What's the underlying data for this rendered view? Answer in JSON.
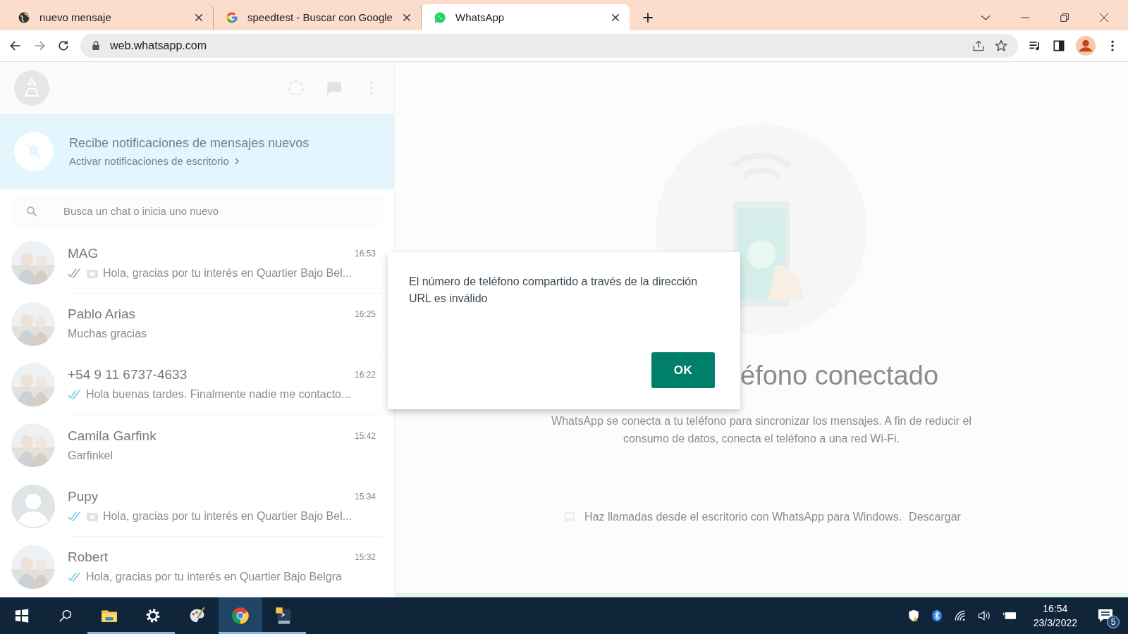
{
  "browser": {
    "tabs": [
      {
        "title": "nuevo mensaje",
        "kind": "globe",
        "selected": false
      },
      {
        "title": "speedtest - Buscar con Google",
        "kind": "google",
        "selected": false
      },
      {
        "title": "WhatsApp",
        "kind": "whatsapp",
        "selected": true
      }
    ],
    "address": "web.whatsapp.com"
  },
  "sidebar": {
    "notification": {
      "title": "Recibe notificaciones de mensajes nuevos",
      "link": "Activar notificaciones de escritorio"
    },
    "search": {
      "placeholder": "Busca un chat o inicia uno nuevo"
    },
    "chats": [
      {
        "name": "MAG",
        "time": "16:53",
        "preview": "Hola, gracias por tu interés en Quartier Bajo Bel...",
        "ticks": true,
        "read": false,
        "photo_attached": true,
        "default_avatar": false
      },
      {
        "name": "Pablo Arias",
        "time": "16:25",
        "preview": "Muchas gracias",
        "ticks": false,
        "photo_attached": false,
        "default_avatar": false
      },
      {
        "name": "+54 9 11 6737-4633",
        "time": "16:22",
        "preview": "Hola buenas tardes. Finalmente nadie me contacto...",
        "ticks": true,
        "read": true,
        "photo_attached": false,
        "default_avatar": false
      },
      {
        "name": "Camila Garfink",
        "time": "15:42",
        "preview": "Garfinkel",
        "ticks": false,
        "photo_attached": false,
        "default_avatar": false
      },
      {
        "name": "Pupy",
        "time": "15:34",
        "preview": "Hola, gracias por tu interés en Quartier Bajo Bel...",
        "ticks": true,
        "read": true,
        "photo_attached": true,
        "default_avatar": true
      },
      {
        "name": "Robert",
        "time": "15:32",
        "preview": "Hola, gracias por tu interés en Quartier Bajo Belgra",
        "ticks": true,
        "read": true,
        "photo_attached": false,
        "default_avatar": false
      }
    ]
  },
  "intro": {
    "title": "éfono conectado",
    "text": "WhatsApp se conecta a tu teléfono para sincronizar los mensajes. A fin de reducir el consumo de datos, conecta el teléfono a una red Wi-Fi.",
    "download_text": "Haz llamadas desde el escritorio con WhatsApp para Windows.",
    "download_link": "Descargar"
  },
  "dialog": {
    "message": "El número de teléfono compartido a través de la dirección URL es inválido",
    "button": "OK"
  },
  "taskbar": {
    "apps": [
      {
        "kind": "start",
        "running": false,
        "selected": false
      },
      {
        "kind": "search",
        "running": false,
        "selected": false
      },
      {
        "kind": "explorer",
        "running": true,
        "selected": false
      },
      {
        "kind": "settings",
        "running": true,
        "selected": false
      },
      {
        "kind": "paint",
        "running": false,
        "selected": false
      },
      {
        "kind": "chrome",
        "running": true,
        "selected": true
      },
      {
        "kind": "python",
        "running": true,
        "selected": false
      }
    ],
    "time": "16:54",
    "date": "23/3/2022",
    "notifications": "5"
  }
}
